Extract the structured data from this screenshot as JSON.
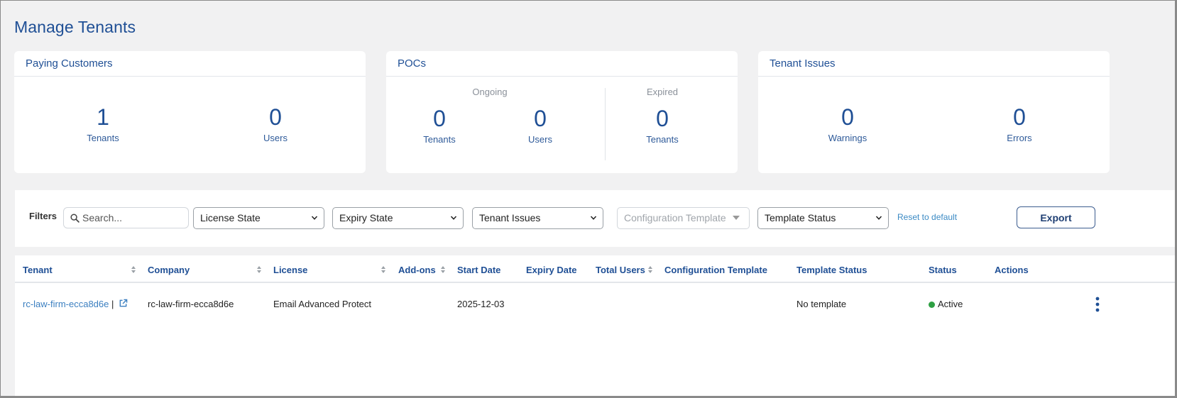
{
  "page": {
    "title": "Manage Tenants"
  },
  "cards": {
    "paying": {
      "title": "Paying Customers",
      "tenants_value": "1",
      "tenants_label": "Tenants",
      "users_value": "0",
      "users_label": "Users"
    },
    "pocs": {
      "title": "POCs",
      "ongoing_label": "Ongoing",
      "expired_label": "Expired",
      "ongoing_tenants_value": "0",
      "ongoing_tenants_label": "Tenants",
      "ongoing_users_value": "0",
      "ongoing_users_label": "Users",
      "expired_tenants_value": "0",
      "expired_tenants_label": "Tenants"
    },
    "issues": {
      "title": "Tenant Issues",
      "warnings_value": "0",
      "warnings_label": "Warnings",
      "errors_value": "0",
      "errors_label": "Errors"
    }
  },
  "filters": {
    "label": "Filters",
    "search_placeholder": "Search...",
    "license_state": "License State",
    "expiry_state": "Expiry State",
    "tenant_issues": "Tenant Issues",
    "configuration_template": "Configuration Template",
    "template_status": "Template Status",
    "reset_label": "Reset to default",
    "export_label": "Export"
  },
  "table": {
    "columns": [
      "Tenant",
      "Company",
      "License",
      "Add-ons",
      "Start Date",
      "Expiry Date",
      "Total Users",
      "Configuration Template",
      "Template Status",
      "Status",
      "Actions"
    ],
    "rows": [
      {
        "tenant": "rc-law-firm-ecca8d6e",
        "separator": "|",
        "company": "rc-law-firm-ecca8d6e",
        "license": "Email Advanced Protect",
        "addons": "",
        "start_date": "2025-12-03",
        "expiry_date": "",
        "total_users": "",
        "configuration_template": "",
        "template_status": "No template",
        "status": "Active"
      }
    ]
  },
  "colors": {
    "primary": "#1f4f95",
    "link": "#3b7fc0",
    "status_active": "#2ea043"
  },
  "icons": [
    "search-icon",
    "chevron-down-icon",
    "sort-icon",
    "external-link-icon",
    "kebab-menu-icon",
    "status-dot-icon"
  ]
}
